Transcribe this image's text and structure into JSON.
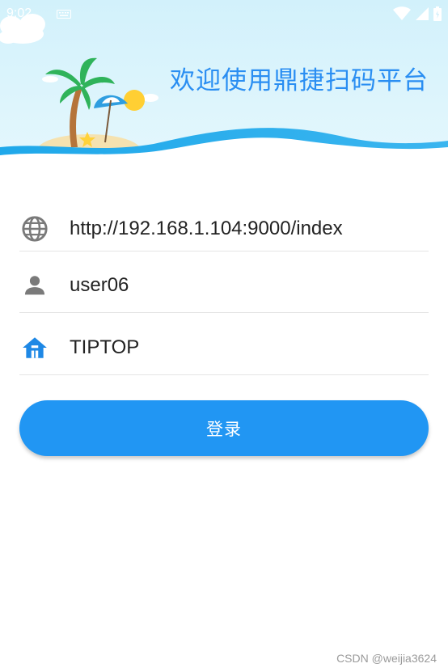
{
  "header": {
    "welcome_text": "欢迎使用鼎捷扫码平台"
  },
  "statusbar": {
    "time": "9:02"
  },
  "form": {
    "server_url": "http://192.168.1.104:9000/index",
    "username": "user06",
    "company": "TIPTOP"
  },
  "login": {
    "label": "登录"
  },
  "icons": {
    "server": "globe-icon",
    "user": "person-icon",
    "company": "home-icon"
  },
  "colors": {
    "primary": "#2196f3",
    "title": "#2a8ef2",
    "sky": "#d6f2fb",
    "icon_gray": "#7a7a7a"
  },
  "watermark": "CSDN @weijia3624"
}
